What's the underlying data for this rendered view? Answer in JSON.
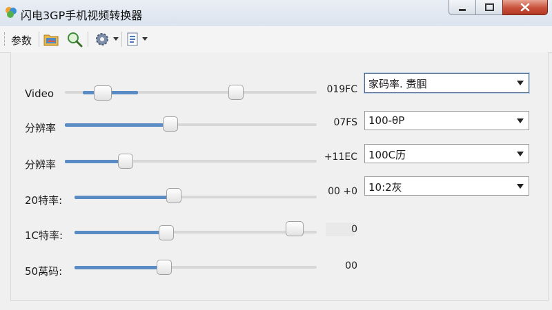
{
  "window": {
    "title": "闪电3GP手机视频转换器"
  },
  "toolbar": {
    "params_label": "参数"
  },
  "rows": [
    {
      "label": "Video",
      "value": "019FC",
      "progress": 0.29,
      "range_low": 0.15,
      "range_high": 0.68
    },
    {
      "label": "分辨率",
      "value": "07FS",
      "progress": 0.42
    },
    {
      "label": "分辨率",
      "value": "+11EC",
      "progress": 0.24
    },
    {
      "label": "20特率:",
      "value": "00 +0",
      "progress": 0.41
    },
    {
      "label": "1C特率:",
      "value": "0",
      "progress": 0.38,
      "range_high": 0.91
    },
    {
      "label": "50莴码:",
      "value": "00",
      "progress": 0.37
    }
  ],
  "selects": [
    {
      "value": "家码率. 赉腘"
    },
    {
      "value": "100-θP"
    },
    {
      "value": "100C历"
    },
    {
      "value": "10:2灰"
    }
  ]
}
